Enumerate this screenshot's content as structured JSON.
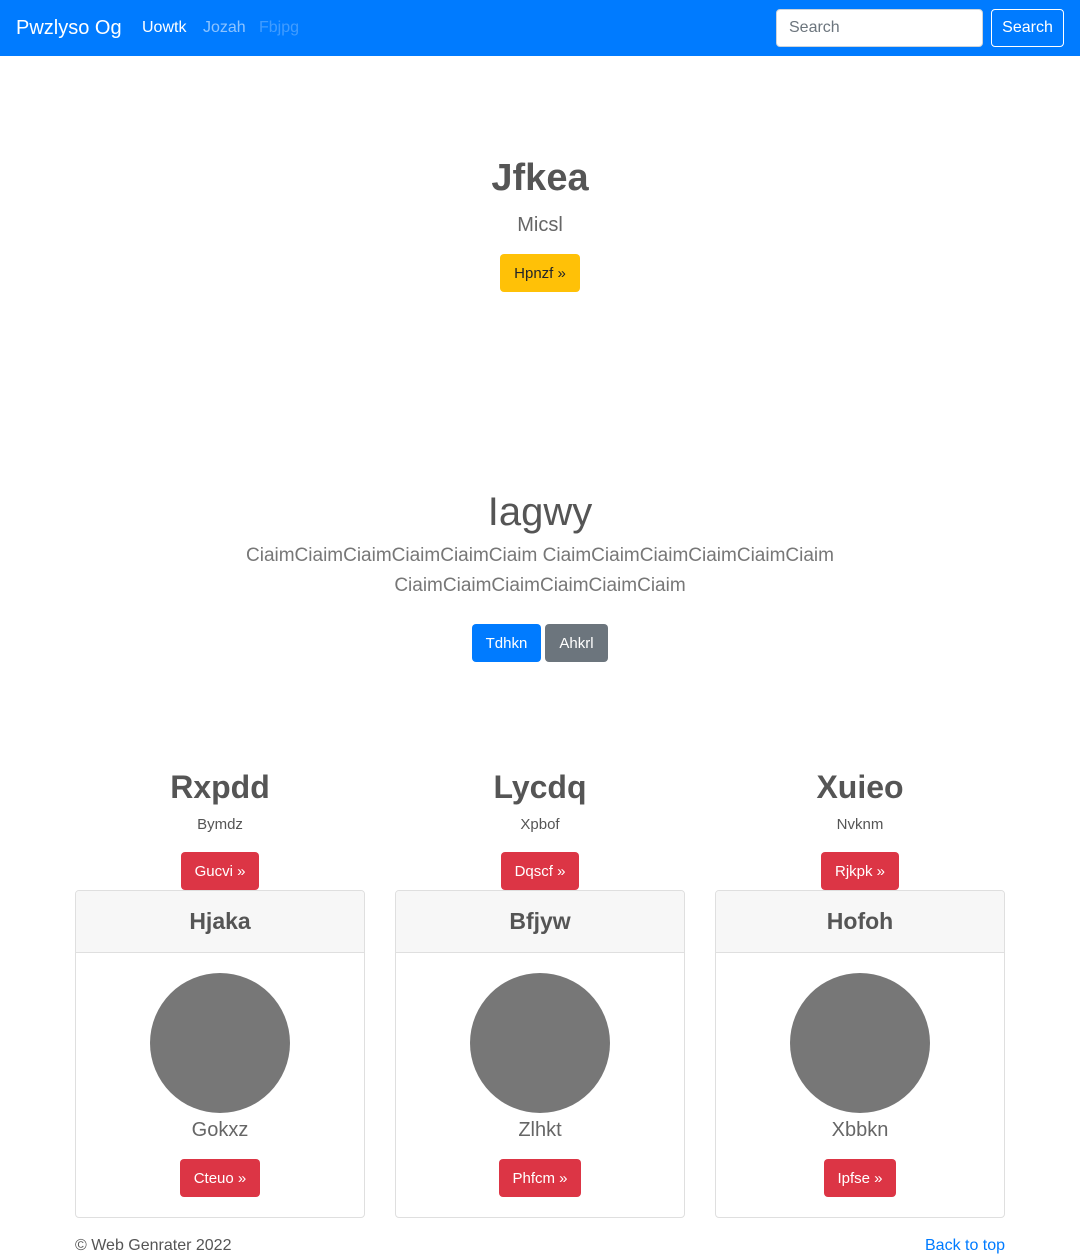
{
  "navbar": {
    "brand": "Pwzlyso Og",
    "links": [
      "Uowtk",
      "Jozah",
      "Fbjpg"
    ],
    "search_placeholder": "Search",
    "search_button": "Search",
    "color": "#007bff"
  },
  "hero": {
    "title": "Jfkea",
    "subtitle": "Micsl",
    "button": "Hpnzf »"
  },
  "section2": {
    "title": "Iagwy",
    "lead": "CiaimCiaimCiaimCiaimCiaimCiaim CiaimCiaimCiaimCiaimCiaimCiaim CiaimCiaimCiaimCiaimCiaimCiaim",
    "buttons": [
      "Tdhkn",
      "Ahkrl"
    ]
  },
  "columns": [
    {
      "title": "Rxpdd",
      "subtitle": "Bymdz",
      "button": "Gucvi »"
    },
    {
      "title": "Lycdq",
      "subtitle": "Xpbof",
      "button": "Dqscf »"
    },
    {
      "title": "Xuieo",
      "subtitle": "Nvknm",
      "button": "Rjkpk »"
    }
  ],
  "cards": [
    {
      "header": "Hjaka",
      "text": "Gokxz",
      "button": "Cteuo »"
    },
    {
      "header": "Bfjyw",
      "text": "Zlhkt",
      "button": "Phfcm »"
    },
    {
      "header": "Hofoh",
      "text": "Xbbkn",
      "button": "Ipfse »"
    }
  ],
  "footer": {
    "copyright": "© Web Genrater 2022",
    "back_to_top": "Back to top"
  }
}
